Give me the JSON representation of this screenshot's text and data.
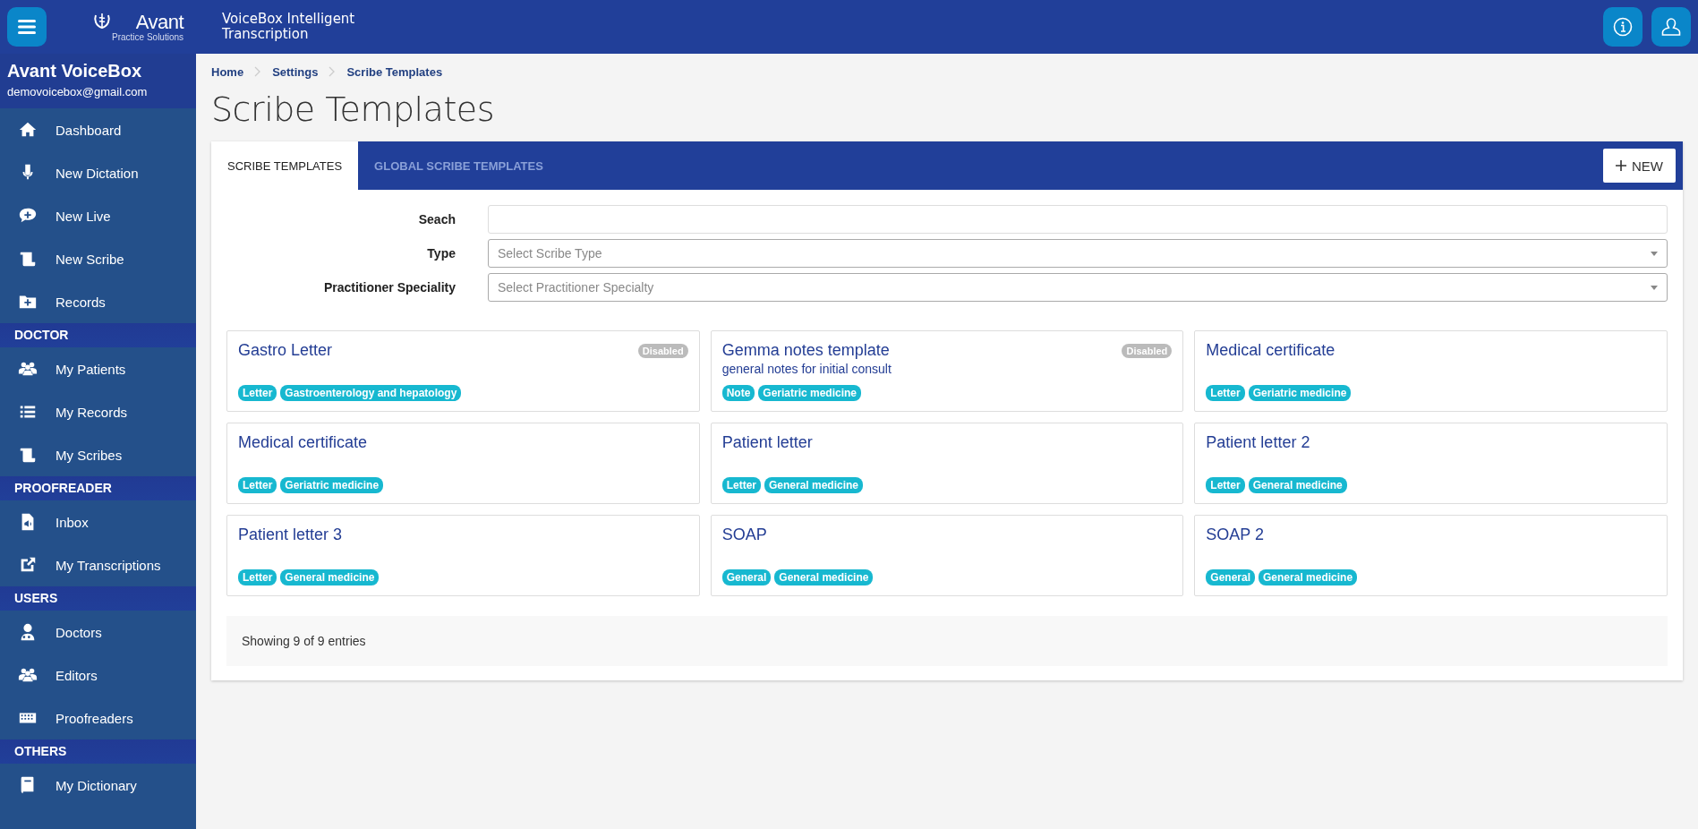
{
  "header": {
    "logo": {
      "name": "Avant",
      "tagline": "Practice Solutions"
    },
    "product": "VoiceBox Intelligent Transcription"
  },
  "sidebar": {
    "title": "Avant VoiceBox",
    "email": "demovoicebox@gmail.com",
    "items": [
      {
        "kind": "link",
        "label": "Dashboard"
      },
      {
        "kind": "link",
        "label": "New Dictation"
      },
      {
        "kind": "link",
        "label": "New Live"
      },
      {
        "kind": "link",
        "label": "New Scribe"
      },
      {
        "kind": "link",
        "label": "Records"
      },
      {
        "kind": "header",
        "label": "DOCTOR"
      },
      {
        "kind": "link",
        "label": "My Patients"
      },
      {
        "kind": "link",
        "label": "My Records"
      },
      {
        "kind": "link",
        "label": "My Scribes"
      },
      {
        "kind": "header",
        "label": "PROOFREADER"
      },
      {
        "kind": "link",
        "label": "Inbox"
      },
      {
        "kind": "link",
        "label": "My Transcriptions"
      },
      {
        "kind": "header",
        "label": "USERS"
      },
      {
        "kind": "link",
        "label": "Doctors"
      },
      {
        "kind": "link",
        "label": "Editors"
      },
      {
        "kind": "link",
        "label": "Proofreaders"
      },
      {
        "kind": "header",
        "label": "OTHERS"
      },
      {
        "kind": "link",
        "label": "My Dictionary"
      }
    ]
  },
  "breadcrumb": [
    "Home",
    "Settings",
    "Scribe Templates"
  ],
  "page_title": "Scribe Templates",
  "tabs": [
    {
      "label": "SCRIBE TEMPLATES",
      "selected": true
    },
    {
      "label": "GLOBAL SCRIBE TEMPLATES",
      "selected": false
    }
  ],
  "new_button": "NEW",
  "filters": [
    {
      "label": "Seach",
      "kind": "text"
    },
    {
      "label": "Type",
      "kind": "select",
      "placeholder": "Select Scribe Type"
    },
    {
      "label": "Practitioner Speciality",
      "kind": "select",
      "placeholder": "Select Practitioner Specialty"
    }
  ],
  "cards": [
    {
      "title": "Gastro Letter",
      "badge": "Disabled",
      "tags": [
        "Letter",
        "Gastroenterology and hepatology"
      ]
    },
    {
      "title": "Gemma notes template",
      "badge": "Disabled",
      "description": "general notes for initial consult",
      "tags": [
        "Note",
        "Geriatric medicine"
      ]
    },
    {
      "title": "Medical certificate",
      "tags": [
        "Letter",
        "Geriatric medicine"
      ]
    },
    {
      "title": "Medical certificate",
      "tags": [
        "Letter",
        "Geriatric medicine"
      ]
    },
    {
      "title": "Patient letter",
      "tags": [
        "Letter",
        "General medicine"
      ]
    },
    {
      "title": "Patient letter 2",
      "tags": [
        "Letter",
        "General medicine"
      ]
    },
    {
      "title": "Patient letter 3",
      "tags": [
        "Letter",
        "General medicine"
      ]
    },
    {
      "title": "SOAP",
      "tags": [
        "General",
        "General medicine"
      ]
    },
    {
      "title": "SOAP 2",
      "tags": [
        "General",
        "General medicine"
      ]
    }
  ],
  "footer": "Showing 9 of 9 entries"
}
